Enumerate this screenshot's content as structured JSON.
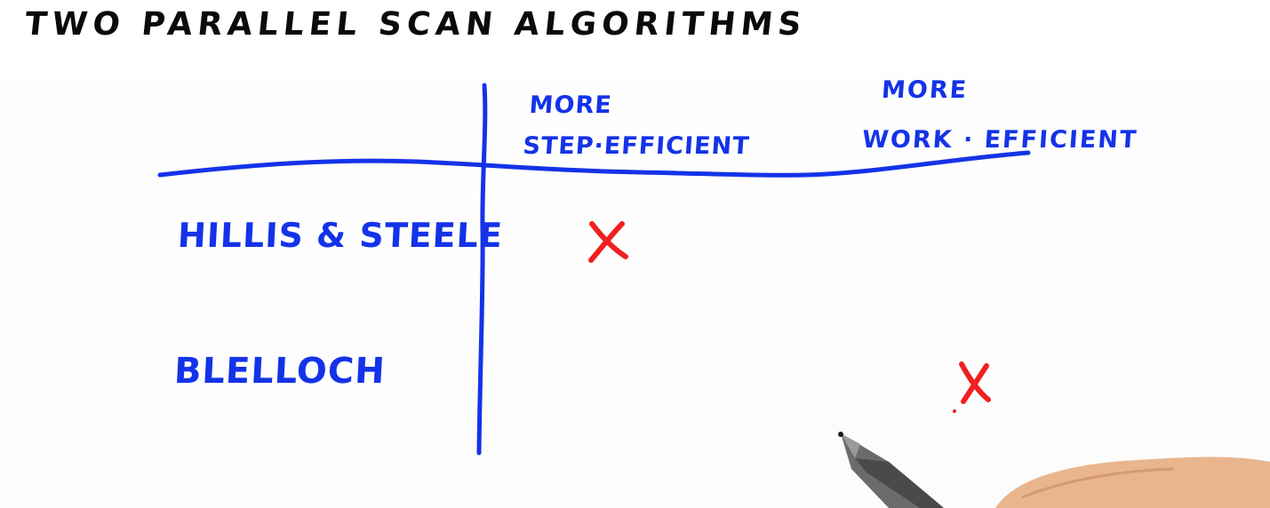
{
  "title": "TWO PARALLEL SCAN ALGORITHMS",
  "table": {
    "columns": [
      {
        "line1": "MORE",
        "line2": "STEP·EFFICIENT"
      },
      {
        "line1": "MORE",
        "line2": "WORK · EFFICIENT"
      }
    ],
    "rows": [
      {
        "label": "HILLIS & STEELE",
        "mark_column": 0
      },
      {
        "label": "BLELLOCH",
        "mark_column": 1
      }
    ]
  },
  "colors": {
    "ink_black": "#0b0b0b",
    "ink_blue": "#1433e8",
    "ink_red": "#f02020"
  },
  "icons": [
    "cross-mark-icon",
    "pen-icon"
  ]
}
